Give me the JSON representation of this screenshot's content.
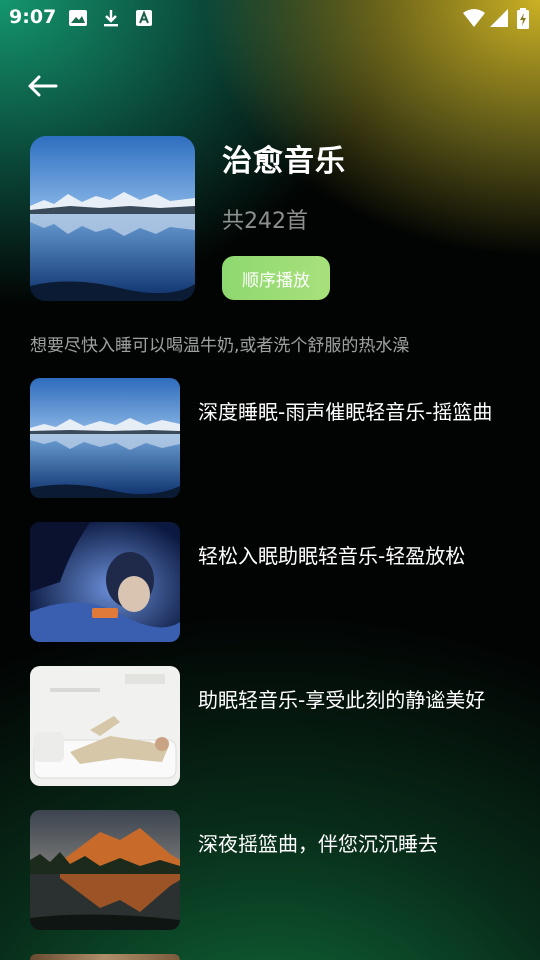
{
  "status_bar": {
    "time": "9:07",
    "left_icons": [
      "image-icon",
      "download-icon",
      "keyboard-a-icon"
    ],
    "right_icons": [
      "wifi-icon",
      "signal-icon",
      "battery-charging-icon"
    ]
  },
  "header": {
    "back_icon": "arrow-left-icon",
    "title": "治愈音乐",
    "count": "共242首",
    "play_button_label": "顺序播放",
    "description": "想要尽快入睡可以喝温牛奶,或者洗个舒服的热水澡"
  },
  "songs": [
    {
      "title": "深度睡眠-雨声催眠轻音乐-摇篮曲"
    },
    {
      "title": "轻松入眠助眠轻音乐-轻盈放松"
    },
    {
      "title": "助眠轻音乐-享受此刻的静谧美好"
    },
    {
      "title": "深夜摇篮曲，伴您沉沉睡去"
    }
  ],
  "colors": {
    "accent": "#94da72",
    "background_top_left": "#149670",
    "background_top_right": "#d6ba26",
    "background_bottom": "#106e3c"
  }
}
